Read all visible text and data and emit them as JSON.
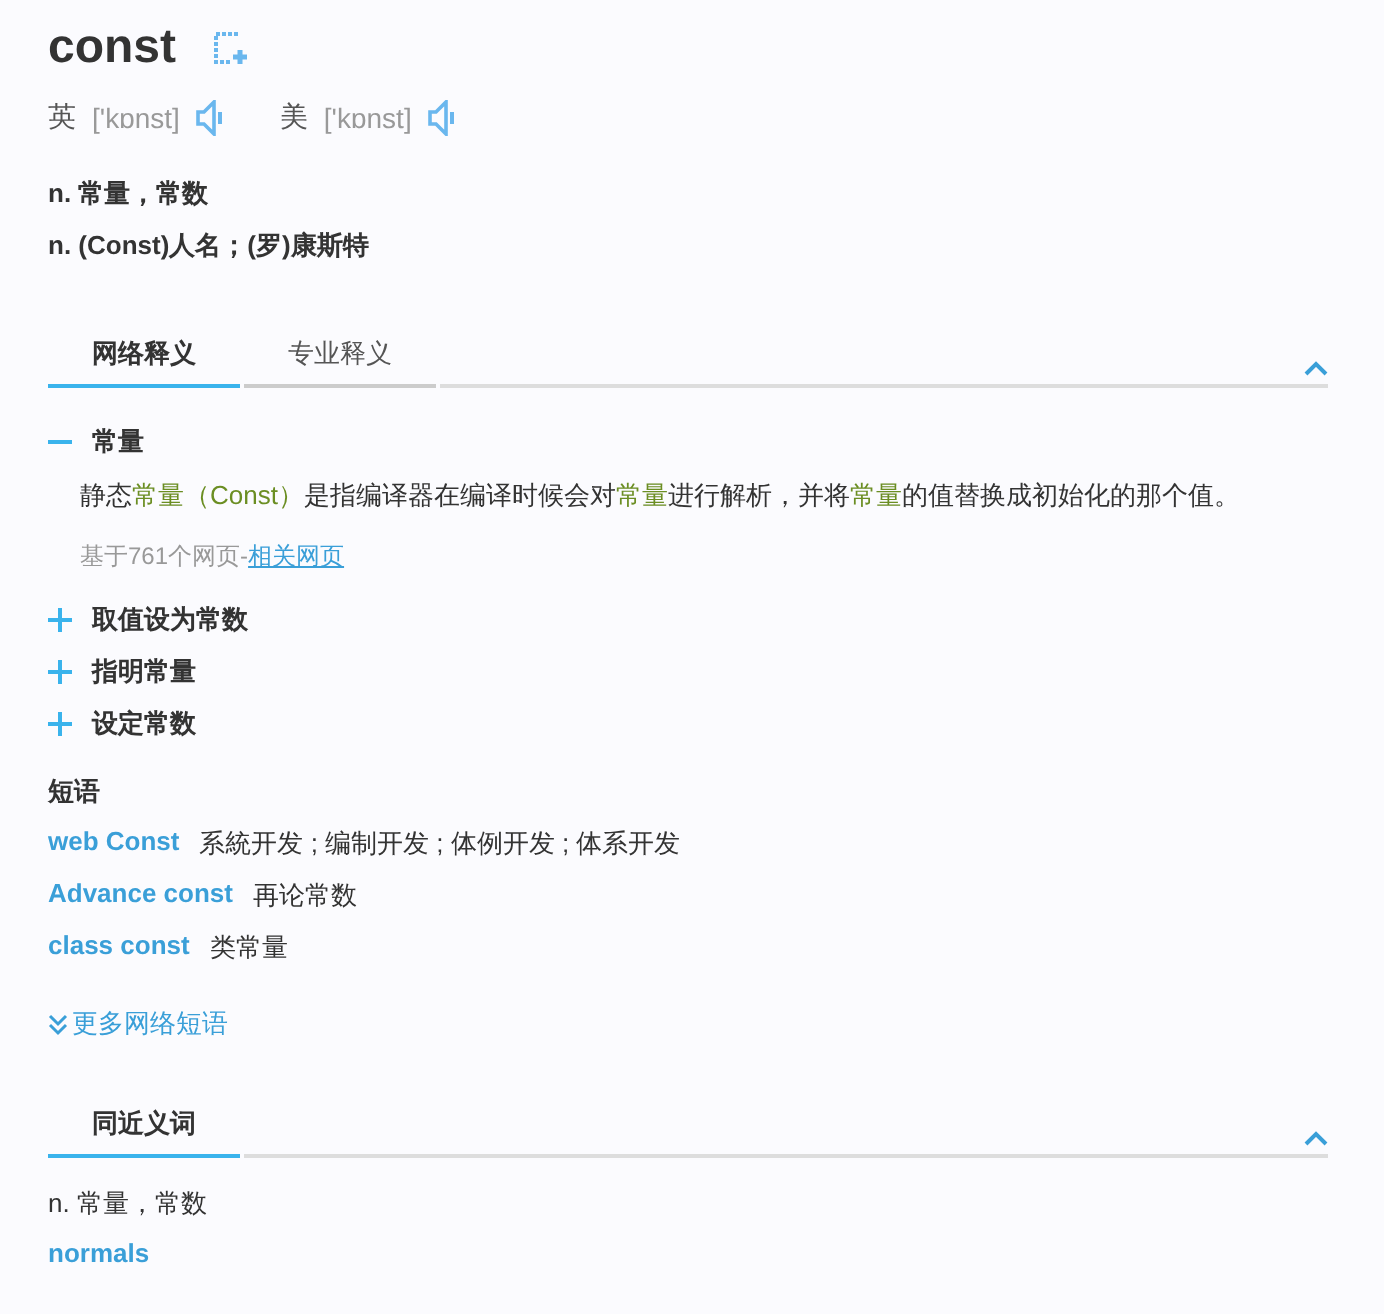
{
  "word": "const",
  "pronunciations": [
    {
      "region": "英",
      "phonetic": "['kɒnst]"
    },
    {
      "region": "美",
      "phonetic": "['kɒnst]"
    }
  ],
  "definitions": [
    "n. 常量，常数",
    "n. (Const)人名；(罗)康斯特"
  ],
  "web_section": {
    "tabs": [
      {
        "label": "网络释义",
        "selected": true
      },
      {
        "label": "专业释义",
        "selected": false
      }
    ],
    "expanded": true,
    "senses": [
      {
        "title": "常量",
        "expanded": true,
        "segments": [
          {
            "text": "静态",
            "highlight": false
          },
          {
            "text": "常量",
            "highlight": true
          },
          {
            "text": "（Const）",
            "highlight": true
          },
          {
            "text": "是指编译器在编译时候会对",
            "highlight": false
          },
          {
            "text": "常量",
            "highlight": true
          },
          {
            "text": "进行解析，并将",
            "highlight": false
          },
          {
            "text": "常量",
            "highlight": true
          },
          {
            "text": "的值替换成初始化的那个值。",
            "highlight": false
          }
        ],
        "source": "基于761个网页-",
        "source_link": "相关网页"
      },
      {
        "title": "取值设为常数",
        "expanded": false
      },
      {
        "title": "指明常量",
        "expanded": false
      },
      {
        "title": "设定常数",
        "expanded": false
      }
    ],
    "phrases_heading": "短语",
    "phrases": [
      {
        "term": "web Const",
        "meaning": "系統开发 ; 编制开发 ; 体例开发 ; 体系开发"
      },
      {
        "term": "Advance const",
        "meaning": "再论常数"
      },
      {
        "term": "class const",
        "meaning": "类常量"
      }
    ],
    "more_link": "更多网络短语"
  },
  "synonym_section": {
    "tabs": [
      {
        "label": "同近义词",
        "selected": true
      }
    ],
    "expanded": true,
    "definition": "n. 常量，常数",
    "words": [
      "normals"
    ]
  }
}
